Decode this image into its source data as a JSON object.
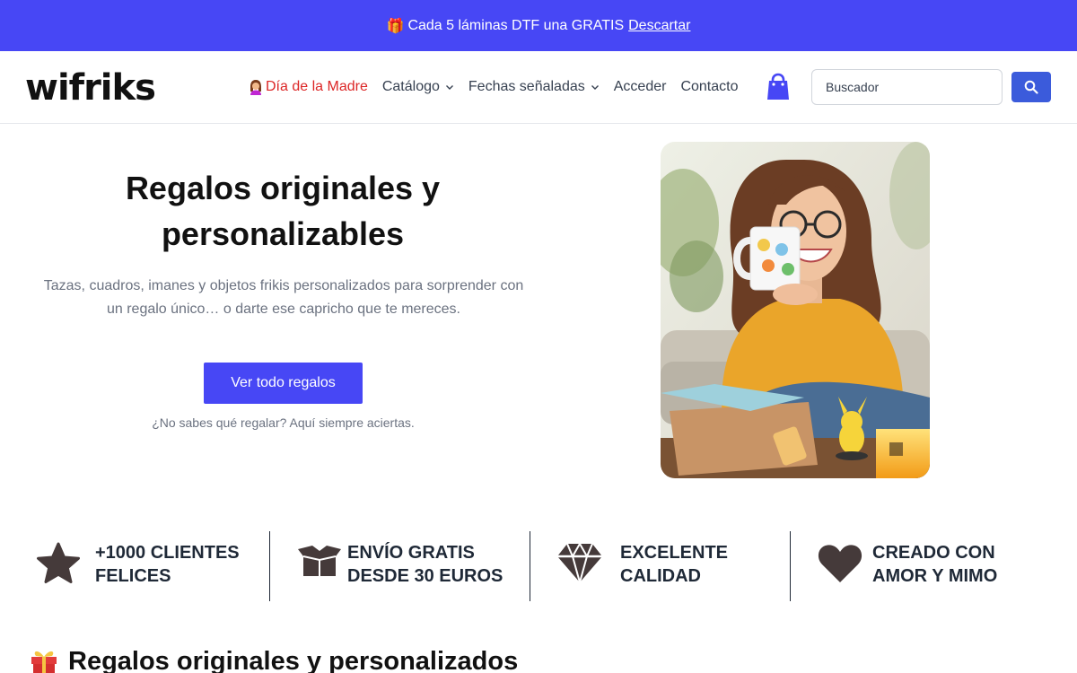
{
  "banner": {
    "gift_icon": "gift-icon",
    "text": "Cada 5 láminas DTF una GRATIS",
    "dismiss_label": "Descartar"
  },
  "header": {
    "logo": "wifriks",
    "nav": [
      {
        "label": "Día de la Madre",
        "icon": "woman-emoji-icon",
        "color": "#dc2626"
      },
      {
        "label": "Catálogo",
        "dropdown": true
      },
      {
        "label": "Fechas señaladas",
        "dropdown": true
      },
      {
        "label": "Acceder"
      },
      {
        "label": "Contacto"
      }
    ],
    "cart_icon": "shopping-bag-icon",
    "search": {
      "placeholder": "Buscador",
      "value": ""
    }
  },
  "hero": {
    "title": "Regalos originales y personalizables",
    "subtitle": "Tazas, cuadros, imanes y objetos frikis personalizados para sorprender con un regalo único… o darte ese capricho que te mereces.",
    "cta_label": "Ver todo regalos",
    "note": "¿No sabes qué regalar? Aquí siempre aciertas."
  },
  "features": [
    {
      "icon": "star-icon",
      "line1": "+1000 CLIENTES",
      "line2": "FELICES"
    },
    {
      "icon": "box-icon",
      "line1": "ENVÍO GRATIS",
      "line2": "DESDE 30 EUROS"
    },
    {
      "icon": "diamond-icon",
      "line1": "EXCELENTE",
      "line2": "CALIDAD"
    },
    {
      "icon": "heart-icon",
      "line1": "CREADO CON",
      "line2": "AMOR Y MIMO"
    }
  ],
  "section": {
    "icon": "gift-icon",
    "title": "Regalos originales y personalizados"
  },
  "colors": {
    "brand": "#4747f5",
    "search_button": "#3b5bdb",
    "highlight_nav": "#dc2626"
  }
}
